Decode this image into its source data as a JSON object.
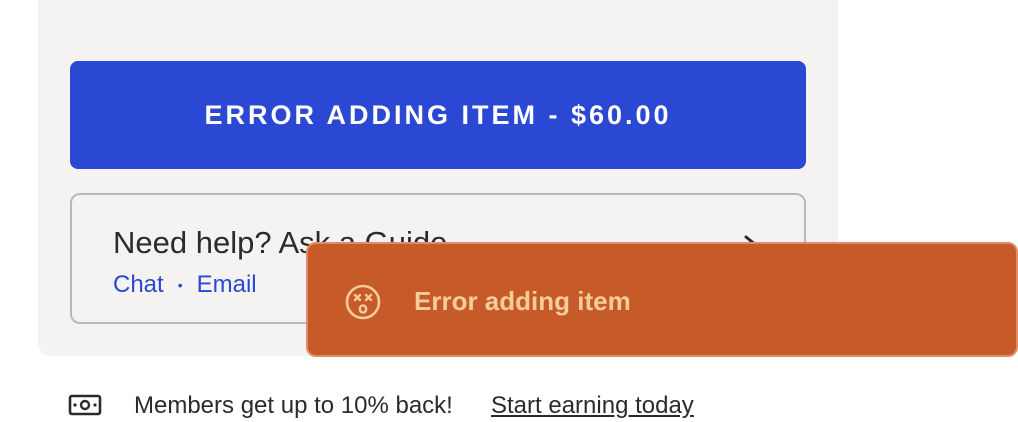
{
  "cart": {
    "add_button_label": "ERROR ADDING ITEM - $60.00"
  },
  "help": {
    "title": "Need help? Ask a Guide",
    "links": [
      "Chat",
      "Email"
    ],
    "separator": "•",
    "arrow_icon": "arrow-right-icon"
  },
  "toast": {
    "message": "Error adding item",
    "icon": "dizzy-face-icon",
    "background": "#c65a28",
    "text_color": "#f6cc9a"
  },
  "footer": {
    "icon": "cash-icon",
    "text": "Members get up to 10% back!",
    "link": "Start earning today"
  },
  "colors": {
    "accent": "#2a48d4",
    "panel_bg": "#f4f3f2"
  }
}
